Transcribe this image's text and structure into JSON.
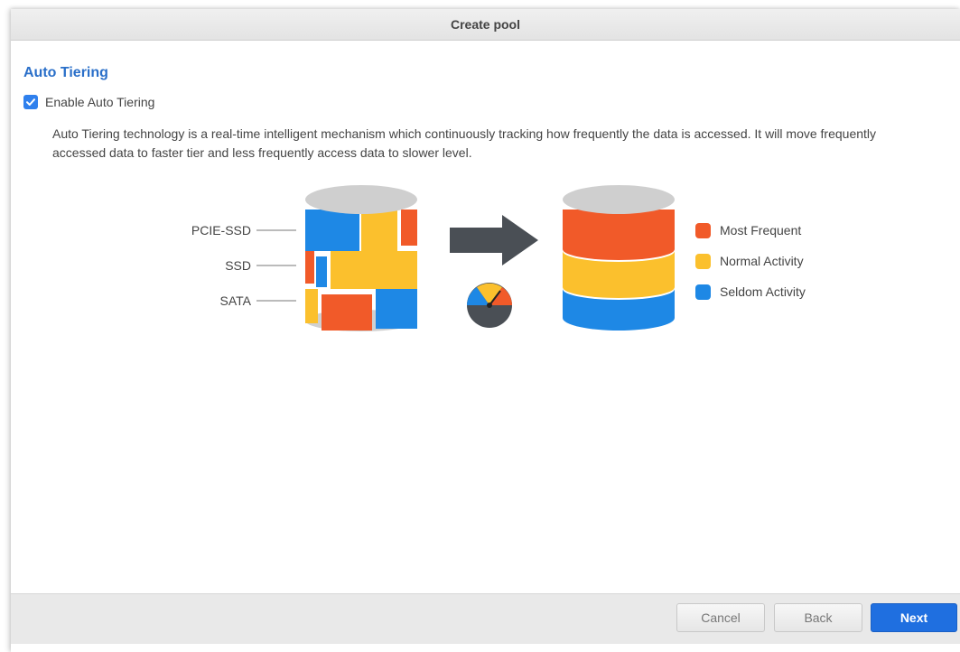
{
  "dialog": {
    "title": "Create pool"
  },
  "section": {
    "title": "Auto Tiering"
  },
  "enable_checkbox": {
    "label": "Enable Auto Tiering",
    "checked": true
  },
  "description": "Auto Tiering technology is a real-time intelligent mechanism which continuously tracking how frequently the data is accessed. It will move frequently accessed data to faster tier and less frequently access data to slower level.",
  "tiers": [
    {
      "label": "PCIE-SSD"
    },
    {
      "label": "SSD"
    },
    {
      "label": "SATA"
    }
  ],
  "legend": [
    {
      "label": "Most Frequent",
      "color": "#f15a29"
    },
    {
      "label": "Normal Activity",
      "color": "#fbc02d"
    },
    {
      "label": "Seldom Activity",
      "color": "#1e88e5"
    }
  ],
  "footer": {
    "cancel_label": "Cancel",
    "back_label": "Back",
    "next_label": "Next"
  }
}
